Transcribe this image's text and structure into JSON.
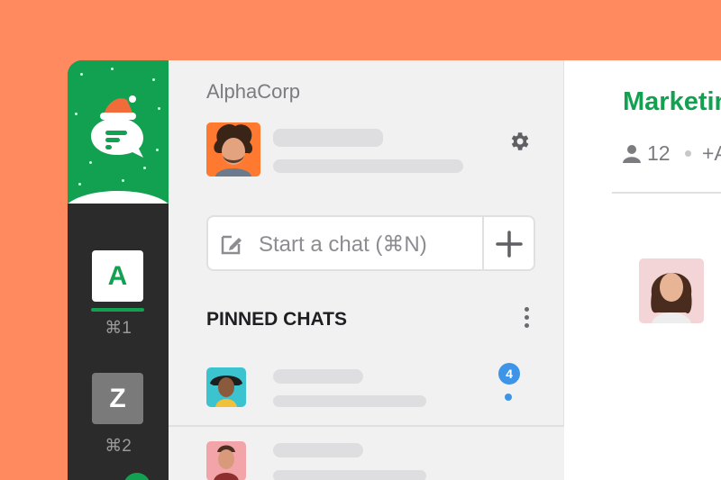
{
  "rail": {
    "logo_icon": "chat-logo-santa-hat",
    "workspaces": [
      {
        "initial": "A",
        "shortcut": "⌘1",
        "active": true
      },
      {
        "initial": "Z",
        "shortcut": "⌘2",
        "active": false
      }
    ]
  },
  "sidebar": {
    "workspace_name": "AlphaCorp",
    "settings_icon": "gear-icon",
    "start_chat": {
      "placeholder": "Start a chat (⌘N)",
      "edit_icon": "compose-icon",
      "add_icon": "plus-icon"
    },
    "pinned": {
      "title": "PINNED CHATS",
      "menu_icon": "kebab-icon",
      "chats": [
        {
          "unread_count": "4",
          "has_unread_dot": true
        },
        {
          "unread_count": "",
          "has_unread_dot": false
        }
      ]
    }
  },
  "conversation": {
    "title": "Marketing",
    "member_count": "12",
    "extra": "+A"
  },
  "colors": {
    "accent": "#12A150",
    "background": "#FF8A5F",
    "rail": "#2B2B2B",
    "badge": "#3E95E8"
  }
}
